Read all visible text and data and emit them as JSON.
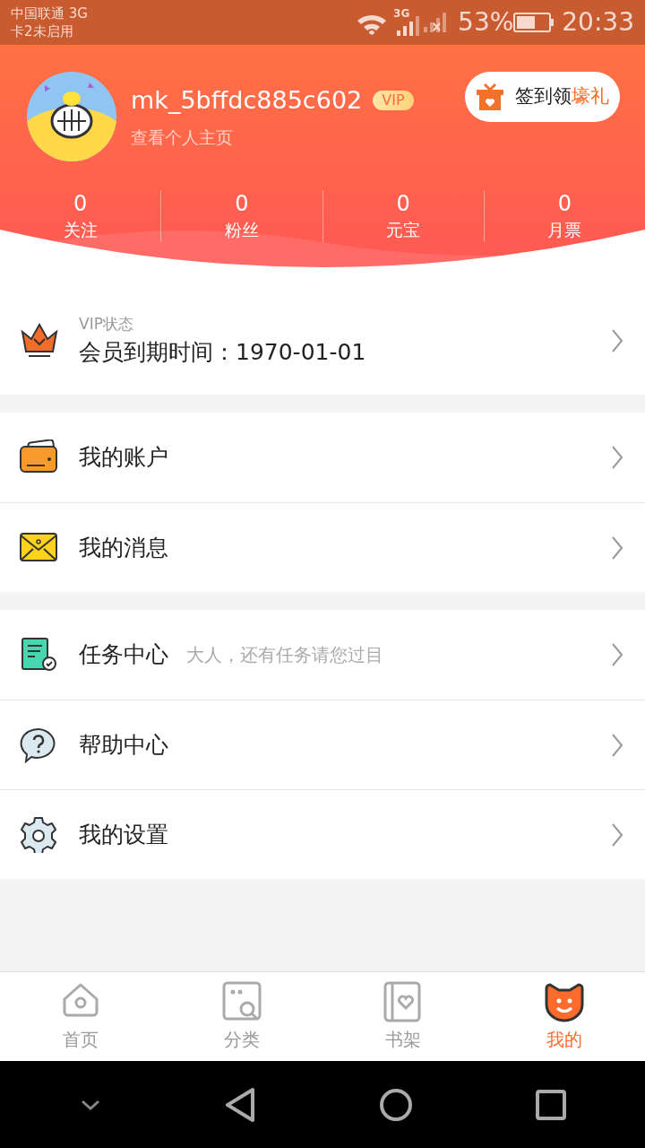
{
  "status_bar": {
    "carrier": "中国联通 3G",
    "sim2": "卡2未启用",
    "network": "3G",
    "battery": "53%",
    "time": "20:33"
  },
  "profile": {
    "username": "mk_5bffdc885c602",
    "badge": "VIP",
    "link": "查看个人主页"
  },
  "sign_in": {
    "text": "签到领",
    "highlight": "壕礼"
  },
  "stats": [
    {
      "value": "0",
      "label": "关注"
    },
    {
      "value": "0",
      "label": "粉丝"
    },
    {
      "value": "0",
      "label": "元宝"
    },
    {
      "value": "0",
      "label": "月票"
    }
  ],
  "vip": {
    "label": "VIP状态",
    "text": "会员到期时间：1970-01-01"
  },
  "menu_groups": [
    [
      {
        "label": "我的账户"
      },
      {
        "label": "我的消息"
      }
    ],
    [
      {
        "label": "任务中心",
        "hint": "大人，还有任务请您过目"
      },
      {
        "label": "帮助中心"
      },
      {
        "label": "我的设置"
      }
    ]
  ],
  "tabs": [
    {
      "label": "首页",
      "selected": false
    },
    {
      "label": "分类",
      "selected": false
    },
    {
      "label": "书架",
      "selected": false
    },
    {
      "label": "我的",
      "selected": true
    }
  ]
}
